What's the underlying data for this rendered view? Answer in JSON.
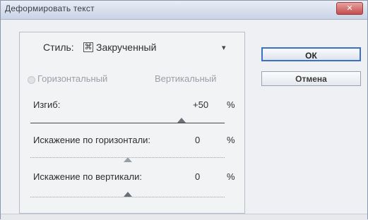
{
  "window": {
    "title": "Деформировать текст",
    "close_label": "✕"
  },
  "style": {
    "label": "Стиль:",
    "icon": "twist-style-icon",
    "value": "Закрученный",
    "dropdown_icon": "▾"
  },
  "orientation": {
    "horizontal": "Горизонтальный",
    "vertical": "Вертикальный",
    "selected": "horizontal"
  },
  "params": [
    {
      "label": "Изгиб:",
      "value": "+50",
      "unit": "%",
      "level": 0.75
    },
    {
      "label": "Искажение по горизонтали:",
      "value": "0",
      "unit": "%",
      "level": 0.5
    },
    {
      "label": "Искажение по вертикали:",
      "value": "0",
      "unit": "%",
      "level": 0.5
    }
  ],
  "buttons": {
    "ok": "ОК",
    "cancel": "Отмена"
  },
  "colors": {
    "accent": "#3b71c4"
  }
}
